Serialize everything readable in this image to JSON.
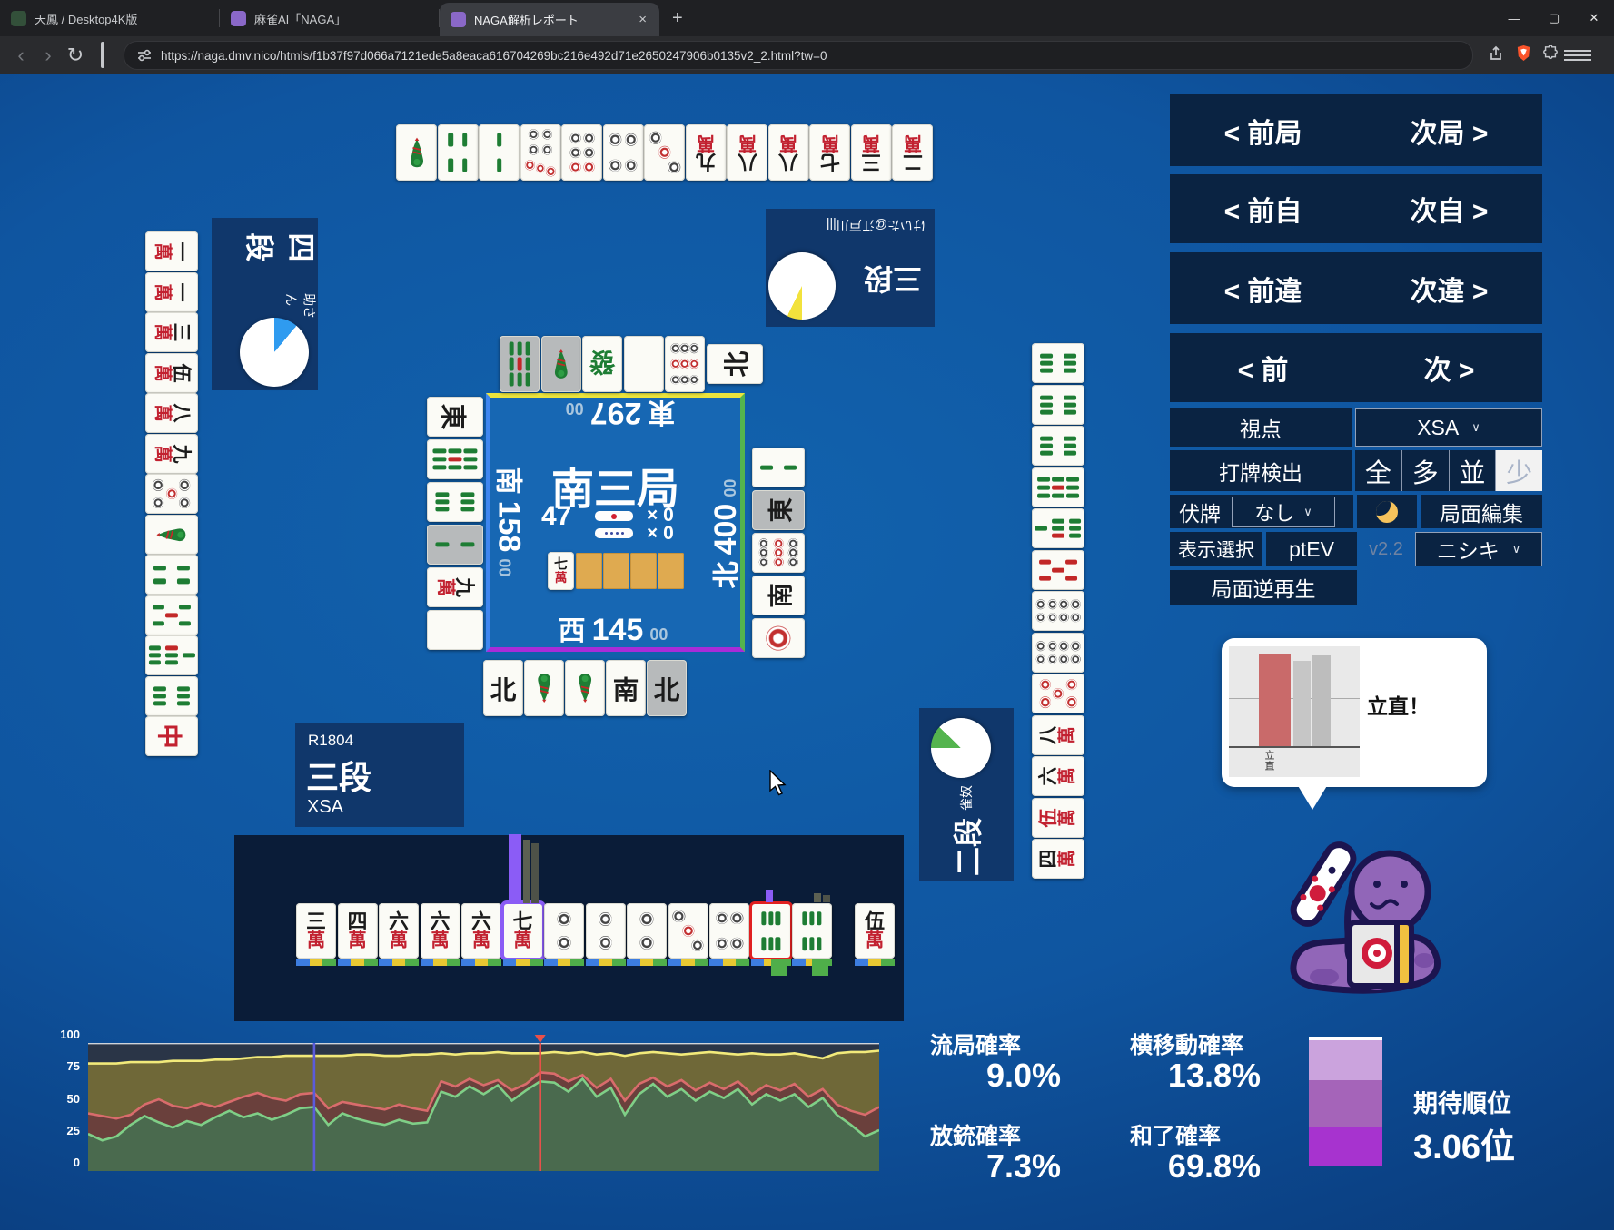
{
  "browser": {
    "tabs": [
      {
        "title": "天鳳 / Desktop4K版",
        "favicon_color": "#33503a",
        "active": false
      },
      {
        "title": "麻雀AI「NAGA」",
        "favicon_color": "#8a68c8",
        "active": false
      },
      {
        "title": "NAGA解析レポート",
        "favicon_color": "#8a68c8",
        "active": true
      }
    ],
    "close_tab": "×",
    "new_tab": "+",
    "window_controls": {
      "minimize": "—",
      "maximize": "▢",
      "close": "✕"
    },
    "nav": {
      "back": "‹",
      "forward": "›",
      "reload": "↻"
    },
    "url": "https://naga.dmv.nico/htmls/f1b37f97d066a7121ede5a8eaca616704269bc216e492d71e2650247906b0135v2_2.html?tw=0"
  },
  "panel": {
    "nav_rows": [
      {
        "left": "< 前局",
        "right": "次局 >"
      },
      {
        "left": "< 前自",
        "right": "次自 >"
      },
      {
        "left": "< 前違",
        "right": "次違 >"
      },
      {
        "left": "< 前",
        "right": "次 >"
      }
    ],
    "viewpoint": {
      "label": "視点",
      "value": "XSA"
    },
    "dahai": {
      "label": "打牌検出",
      "options": [
        "全",
        "多",
        "並",
        "少"
      ],
      "selected": "少"
    },
    "fusehai": {
      "label": "伏牌",
      "value": "なし"
    },
    "edit_label": "局面編集",
    "display_label": "表示選択",
    "ptev_label": "ptEV",
    "version": "v2.2",
    "skin_value": "ニシキ",
    "reverse_label": "局面逆再生"
  },
  "board": {
    "round": "南三局",
    "wall_count": "47",
    "riichi_counter": "× 0",
    "honba_counter": "× 0",
    "seats": {
      "east": {
        "wind": "東",
        "score": "297",
        "sub": "00"
      },
      "south": {
        "wind": "南",
        "score": "158",
        "sub": "00"
      },
      "west": {
        "wind": "西",
        "score": "145",
        "sub": "00"
      },
      "north": {
        "wind": "北",
        "score": "400",
        "sub": "00"
      }
    }
  },
  "players": {
    "left": {
      "rank": "四段",
      "name": "助さん",
      "pie": {
        "color": "#2f9bf0",
        "deg": 40
      }
    },
    "top": {
      "rank": "三段",
      "name": "けいた@江戸川|||",
      "pie": {
        "color": "#f2e23c",
        "deg": 26
      }
    },
    "right": {
      "rank": "二段",
      "name": "雀奴",
      "pie": {
        "color": "#54b44e",
        "deg": 44
      }
    },
    "self": {
      "rating": "R1804",
      "rank": "三段",
      "name": "XSA"
    }
  },
  "tiles": {
    "self_hand": [
      {
        "c": "3m"
      },
      {
        "c": "4m"
      },
      {
        "c": "6m"
      },
      {
        "c": "6m"
      },
      {
        "c": "6m"
      },
      {
        "c": "7m",
        "hl": "purple"
      },
      {
        "c": "2p"
      },
      {
        "c": "2p"
      },
      {
        "c": "2p"
      },
      {
        "c": "3p"
      },
      {
        "c": "4p"
      },
      {
        "c": "6s",
        "hl": "red"
      },
      {
        "c": "6s"
      }
    ],
    "self_draw": [
      {
        "c": "5m"
      }
    ],
    "top_hand": [
      {
        "c": "1s"
      },
      {
        "c": "4s"
      },
      {
        "c": "2s"
      },
      {
        "c": "7p"
      },
      {
        "c": "6p"
      },
      {
        "c": "4p"
      },
      {
        "c": "3p"
      },
      {
        "c": "9m"
      },
      {
        "c": "8m"
      },
      {
        "c": "8m"
      },
      {
        "c": "7m"
      },
      {
        "c": "3m"
      },
      {
        "c": "2m"
      }
    ],
    "left_hand": [
      {
        "c": "1m"
      },
      {
        "c": "1m"
      },
      {
        "c": "3m"
      },
      {
        "c": "5m"
      },
      {
        "c": "8m"
      },
      {
        "c": "9m"
      },
      {
        "c": "5p"
      },
      {
        "c": "1s"
      },
      {
        "c": "4s"
      },
      {
        "c": "5s"
      },
      {
        "c": "7s"
      },
      {
        "c": "6s"
      },
      {
        "c": "C"
      }
    ],
    "right_hand": [
      {
        "c": "6s"
      },
      {
        "c": "6s"
      },
      {
        "c": "6s"
      },
      {
        "c": "9s"
      },
      {
        "c": "7s"
      },
      {
        "c": "5s",
        "r": 1
      },
      {
        "c": "8p"
      },
      {
        "c": "8p"
      },
      {
        "c": "5p",
        "r": 1
      },
      {
        "c": "8m"
      },
      {
        "c": "6m"
      },
      {
        "c": "5m",
        "r": 1
      },
      {
        "c": "4m"
      }
    ],
    "discard_top": [
      {
        "c": "9s",
        "g": 1
      },
      {
        "c": "1s",
        "g": 1
      },
      {
        "c": "F"
      },
      {
        "c": "back"
      },
      {
        "c": "9p"
      },
      {
        "c": "N",
        "side": 1
      }
    ],
    "discard_left": [
      {
        "c": "E"
      },
      {
        "c": "9s"
      },
      {
        "c": "6s"
      },
      {
        "c": "2s",
        "g": 1
      },
      {
        "c": "9m"
      },
      {
        "c": "back"
      }
    ],
    "discard_right": [
      {
        "c": "2s"
      },
      {
        "c": "E",
        "g": 1
      },
      {
        "c": "9p"
      },
      {
        "c": "S"
      },
      {
        "c": "1p"
      }
    ],
    "discard_bottom": [
      {
        "c": "N"
      },
      {
        "c": "1s"
      },
      {
        "c": "1s"
      },
      {
        "c": "S"
      },
      {
        "c": "N",
        "g": 1
      }
    ],
    "dora_indicator": [
      {
        "c": "7m"
      }
    ],
    "dora_backs": 4
  },
  "recommend": {
    "main_color": "#8b5cf6",
    "alt_colors": [
      "#5c6052",
      "#4e5248"
    ],
    "strip_colors": [
      "#3d7de0",
      "#e8c832",
      "#4fae4a"
    ],
    "green_block_color": "#4fae4a"
  },
  "tooltip": {
    "callout": "立直！",
    "label": "立直",
    "bars": [
      {
        "value": 96,
        "color": "#c96a6a",
        "width": 35,
        "x": 33
      },
      {
        "value": 89,
        "color": "#c6c6c6",
        "width": 19,
        "x": 71
      },
      {
        "value": 94,
        "color": "#bdbdbd",
        "width": 20,
        "x": 92
      }
    ]
  },
  "stats": {
    "items": [
      {
        "label": "流局確率",
        "value": "9.0%"
      },
      {
        "label": "横移動確率",
        "value": "13.8%"
      },
      {
        "label": "放銃確率",
        "value": "7.3%"
      },
      {
        "label": "和了確率",
        "value": "69.8%"
      }
    ],
    "rank_label": "期待順位",
    "rank_value": "3.06位",
    "rank_bar": {
      "cap_color": "#ffffff",
      "segments": [
        {
          "color": "#cba3dd",
          "h": 44
        },
        {
          "color": "#a564b9",
          "h": 52
        },
        {
          "color": "#a733cf",
          "h": 42
        }
      ]
    }
  },
  "chart_data": {
    "type": "area",
    "title": "",
    "xlabel": "",
    "ylabel": "",
    "ylim": [
      0,
      100
    ],
    "yticks": [
      100,
      75,
      50,
      25,
      0
    ],
    "grid": false,
    "legend": "none",
    "x_range": [
      0,
      56
    ],
    "series": [
      {
        "name": "yellow",
        "color": "#f2ea7a",
        "fill_above": "#2a3547",
        "values": [
          84,
          84,
          84,
          85,
          85,
          85,
          86,
          86,
          86,
          87,
          87,
          88,
          89,
          89,
          90,
          90,
          90,
          90,
          90,
          91,
          91,
          90,
          90,
          91,
          91,
          92,
          91,
          92,
          92,
          93,
          92,
          92,
          92,
          93,
          92,
          93,
          91,
          92,
          90,
          92,
          93,
          92,
          91,
          92,
          93,
          92,
          91,
          92,
          91,
          91,
          92,
          90,
          88,
          92,
          93,
          93,
          94
        ]
      },
      {
        "name": "red",
        "color": "#d96c6c",
        "fill_to_yellow": "#6f6838",
        "values": [
          45,
          43,
          41,
          44,
          52,
          56,
          51,
          49,
          53,
          50,
          54,
          58,
          61,
          57,
          55,
          60,
          61,
          49,
          54,
          52,
          50,
          48,
          52,
          49,
          47,
          70,
          66,
          72,
          67,
          71,
          63,
          68,
          77,
          76,
          70,
          75,
          65,
          72,
          55,
          68,
          73,
          66,
          71,
          63,
          69,
          64,
          70,
          60,
          67,
          63,
          68,
          58,
          64,
          52,
          47,
          44,
          50
        ]
      },
      {
        "name": "green",
        "color": "#7fcf87",
        "fill_to_red": "#6a403c",
        "fill_below": "#4a6a4e",
        "values": [
          29,
          24,
          27,
          36,
          43,
          38,
          34,
          39,
          36,
          42,
          47,
          42,
          45,
          40,
          44,
          49,
          50,
          36,
          45,
          41,
          38,
          36,
          40,
          37,
          38,
          62,
          58,
          66,
          60,
          67,
          55,
          63,
          70,
          69,
          62,
          72,
          58,
          65,
          44,
          60,
          68,
          58,
          64,
          55,
          62,
          57,
          64,
          52,
          60,
          55,
          60,
          50,
          57,
          44,
          36,
          27,
          32
        ]
      }
    ],
    "markers": [
      {
        "type": "vline",
        "index": 16,
        "color": "#5b5bdb"
      },
      {
        "type": "vline",
        "index": 32,
        "color": "#e8504a",
        "triangle": true
      }
    ]
  }
}
